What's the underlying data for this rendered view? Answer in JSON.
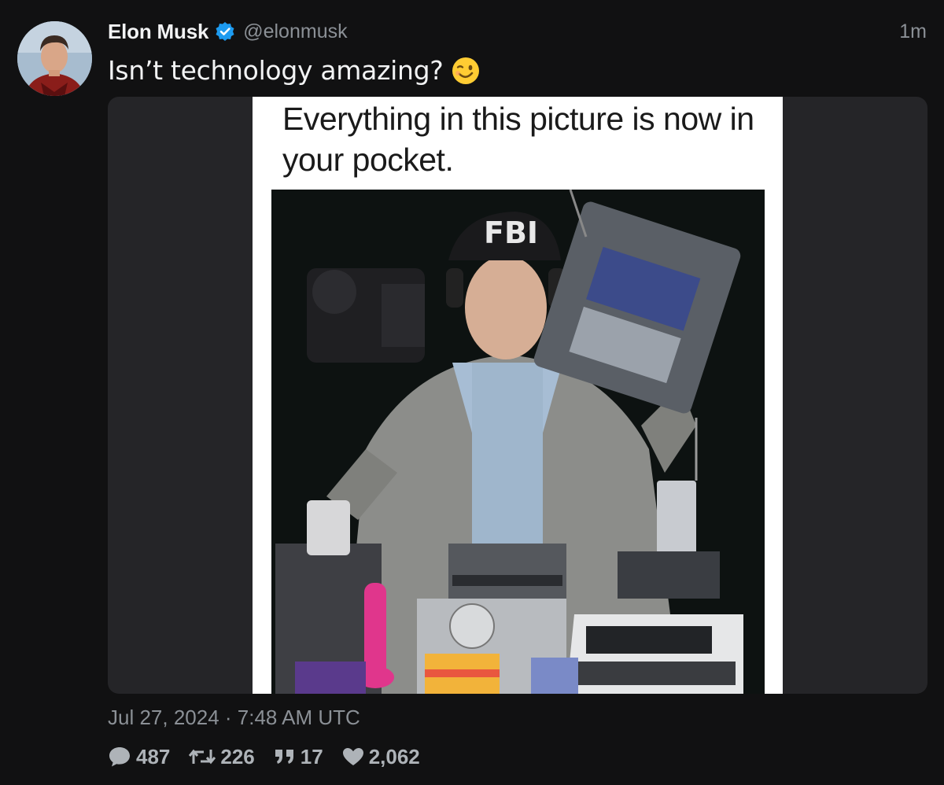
{
  "tweet": {
    "author_name": "Elon Musk",
    "author_handle": "@elonmusk",
    "verified": true,
    "relative_time": "1m",
    "text": "Isn’t technology amazing?",
    "emoji": "winking-face-emoji",
    "media": {
      "caption": "Everything in this picture is now in your pocket."
    },
    "timestamp": "Jul 27, 2024 · 7:48 AM UTC",
    "stats": {
      "replies": "487",
      "retweets": "226",
      "quotes": "17",
      "likes": "2,062"
    }
  },
  "icons": {
    "verified": "verified-badge-icon",
    "reply": "speech-bubble-icon",
    "retweet": "retweet-icon",
    "quote": "quote-icon",
    "like": "heart-icon"
  },
  "colors": {
    "background": "#111112",
    "verified": "#1d9bf0",
    "muted_text": "#8b9096",
    "text": "#f2f3f4"
  }
}
